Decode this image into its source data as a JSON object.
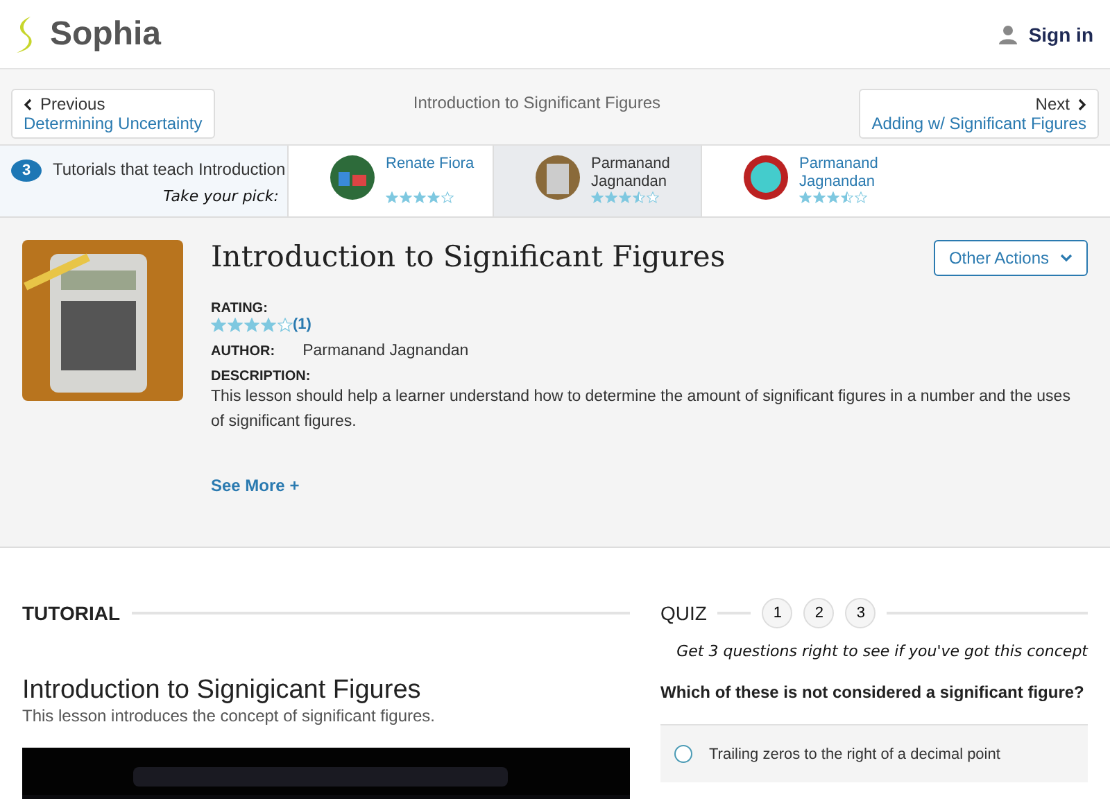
{
  "header": {
    "logo": "Sophia",
    "sign_in": "Sign in"
  },
  "nav": {
    "previous": {
      "label": "Previous",
      "title": "Determining Uncertainty"
    },
    "current": "Introduction to Significant Figures",
    "next": {
      "label": "Next",
      "title": "Adding w/ Significant Figures"
    }
  },
  "tutorials": {
    "count": "3",
    "text": "Tutorials that teach Introduction",
    "pick": "Take your pick:",
    "items": [
      {
        "author": "Renate Fiora",
        "stars": 4,
        "selected": false
      },
      {
        "author": "Parmanand Jagnandan",
        "stars": 3.5,
        "selected": true
      },
      {
        "author": "Parmanand Jagnandan",
        "stars": 3.5,
        "selected": false
      }
    ]
  },
  "lesson": {
    "title": "Introduction to Significant Figures",
    "actions": "Other Actions",
    "rating_label": "RATING:",
    "stars": 4,
    "rating_count": "(1)",
    "author_label": "AUTHOR:",
    "author": "Parmanand Jagnandan",
    "description_label": "DESCRIPTION:",
    "description": "This lesson should help a learner understand how to determine the amount of significant figures in a number and the uses of significant figures.",
    "see_more": "See More +"
  },
  "tutorial": {
    "heading": "TUTORIAL",
    "title": "Introduction to Signigicant Figures",
    "subtitle": "This lesson introduces the concept of significant figures."
  },
  "quiz": {
    "heading": "QUIZ",
    "steps": [
      "1",
      "2",
      "3"
    ],
    "prompt": "Get 3 questions right to see if you've got this concept",
    "question": "Which of these is not considered a significant figure?",
    "answers": [
      {
        "text": "Trailing zeros to the right of a decimal point",
        "selected": false
      }
    ]
  }
}
